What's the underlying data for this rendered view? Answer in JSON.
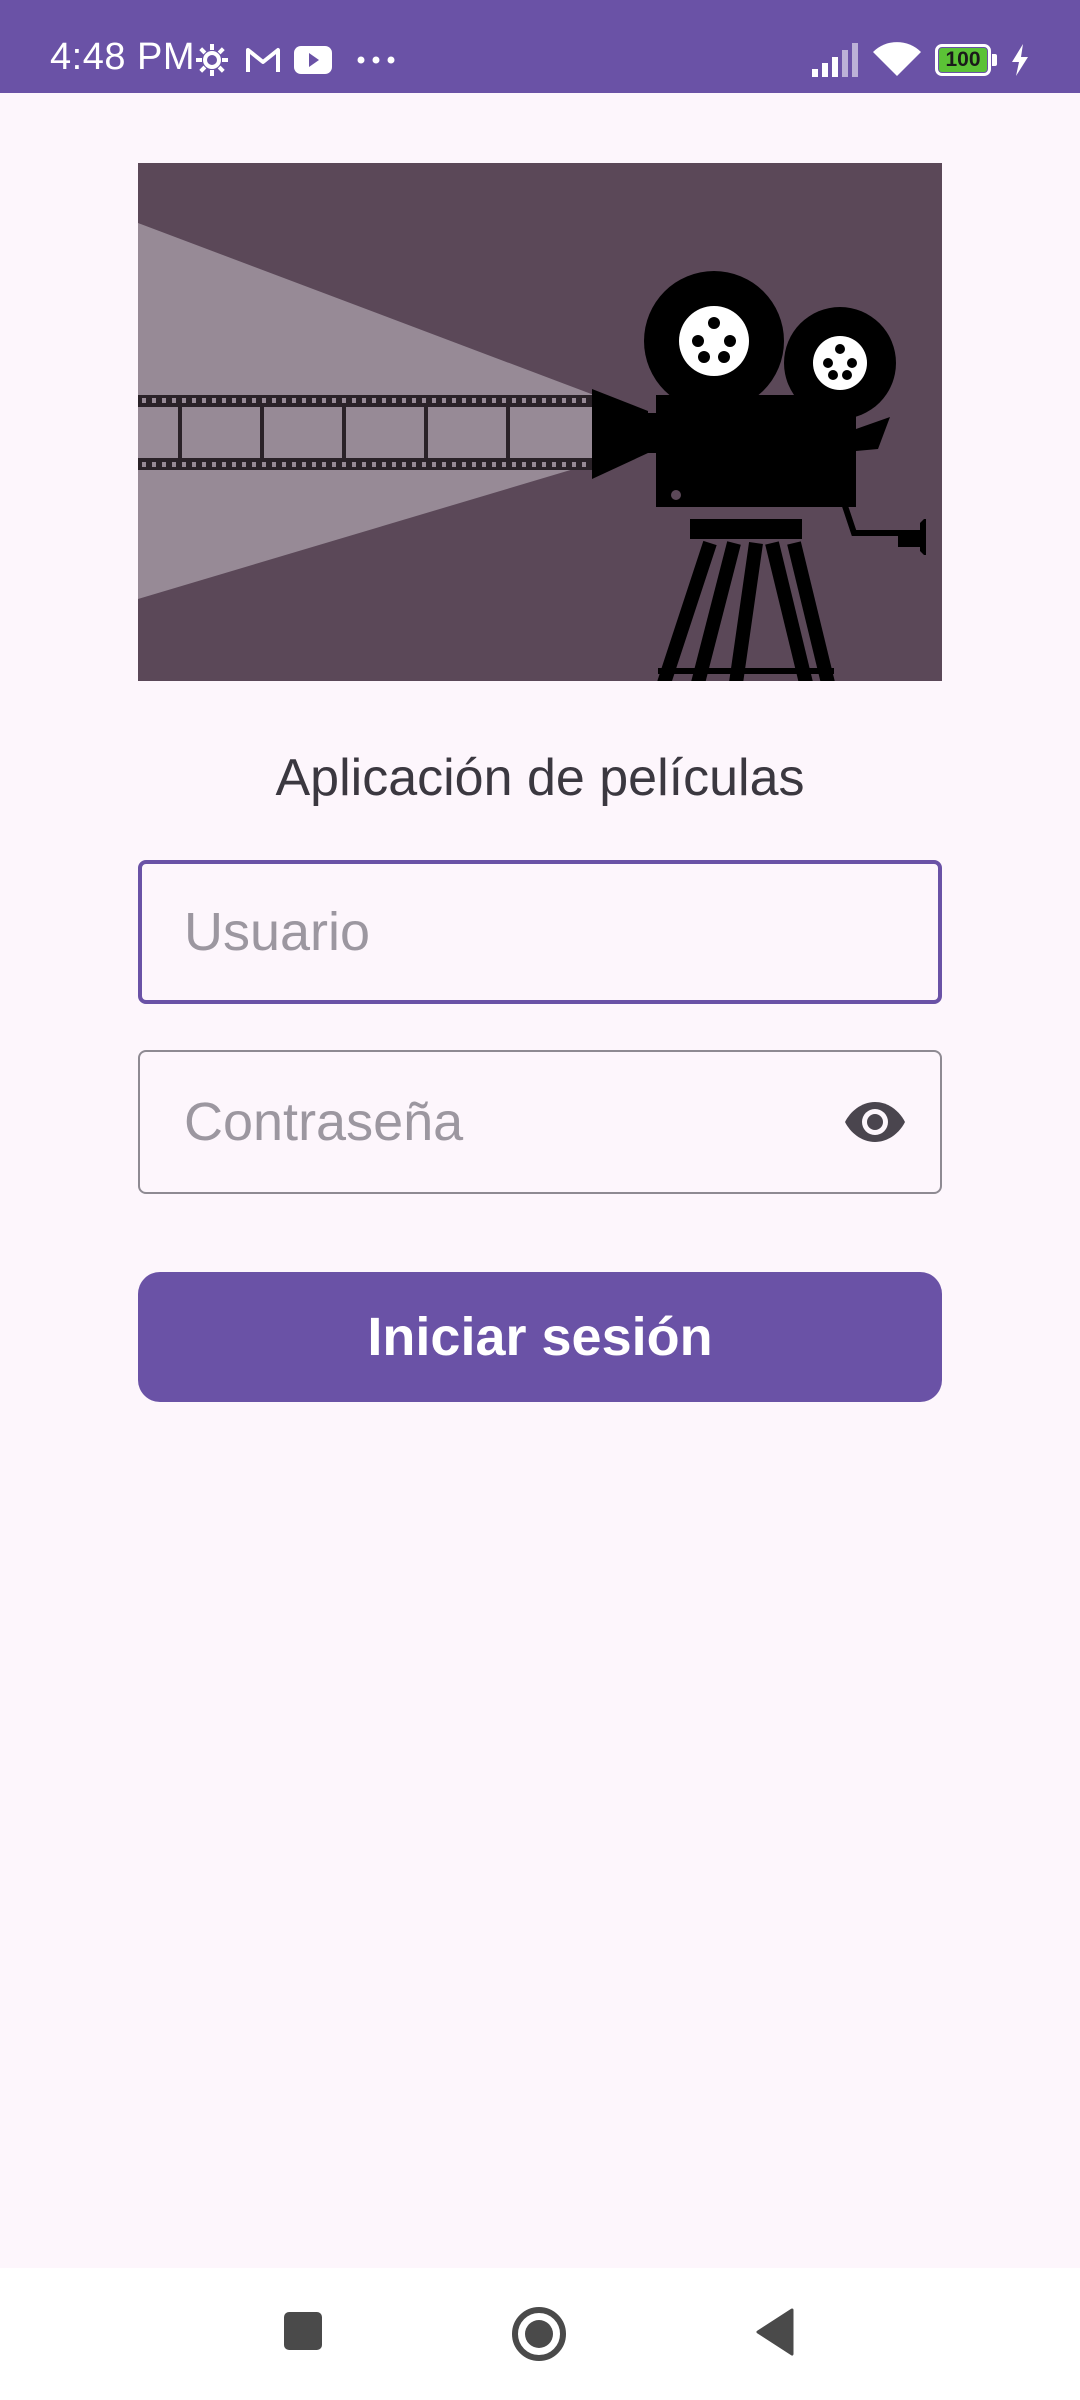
{
  "status_bar": {
    "time": "4:48 PM",
    "battery_level": "100",
    "icons": [
      "settings-icon",
      "gmail-icon",
      "youtube-icon",
      "more-dots-icon",
      "signal-icon",
      "wifi-icon",
      "battery-icon",
      "charging-icon"
    ]
  },
  "hero": {
    "icon": "movie-camera-illustration"
  },
  "app_title": "Aplicación de películas",
  "username": {
    "placeholder": "Usuario",
    "value": ""
  },
  "password": {
    "placeholder": "Contraseña",
    "value": "",
    "toggle_icon": "eye-icon"
  },
  "login_button": {
    "label": "Iniciar sesión"
  },
  "colors": {
    "primary": "#6A52A6",
    "background": "#FDF6FC",
    "hero_background": "#5B4858",
    "outline": "#8E8A92",
    "placeholder": "#9C97A0"
  },
  "nav_bar": {
    "icons": [
      "recents-square-icon",
      "home-circle-icon",
      "back-triangle-icon"
    ]
  }
}
